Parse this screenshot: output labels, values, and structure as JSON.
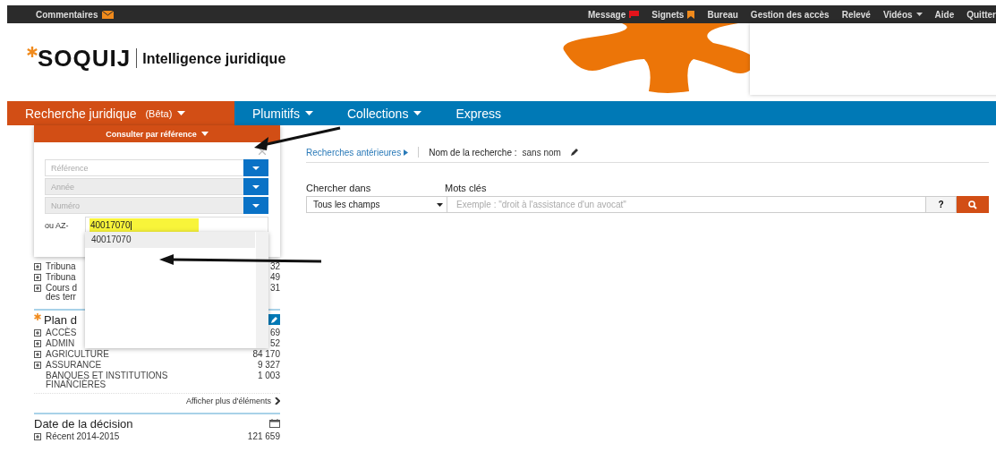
{
  "top_bar": {
    "feedback": "Commentaires",
    "links": [
      {
        "label": "Message",
        "kind": "flag"
      },
      {
        "label": "Signets",
        "kind": "bookmark"
      },
      {
        "label": "Bureau",
        "kind": "plain"
      },
      {
        "label": "Gestion des accès",
        "kind": "plain"
      },
      {
        "label": "Relevé",
        "kind": "plain"
      },
      {
        "label": "Vidéos",
        "kind": "dropdown"
      },
      {
        "label": "Aide",
        "kind": "plain"
      },
      {
        "label": "Quitter",
        "kind": "plain"
      }
    ]
  },
  "header": {
    "brand": "SOQUIJ",
    "tagline": "Intelligence juridique"
  },
  "nav": [
    {
      "label": "Recherche juridique",
      "badge": "(Bêta)",
      "selected": true,
      "dropdown": true
    },
    {
      "label": "Plumitifs",
      "selected": false,
      "dropdown": true
    },
    {
      "label": "Collections",
      "selected": false,
      "dropdown": true
    },
    {
      "label": "Express",
      "selected": false,
      "dropdown": false
    }
  ],
  "sidebar": {
    "courts": [
      {
        "lines": [
          "Tribuna"
        ],
        "count": "32"
      },
      {
        "lines": [
          "Tribuna"
        ],
        "count": "49"
      },
      {
        "lines": [
          "Cours d",
          "des terr"
        ],
        "count": "31"
      }
    ],
    "plan": {
      "title": "Plan d",
      "items": [
        {
          "lines": [
            "ACCÈS"
          ],
          "count": "69",
          "expandable": true
        },
        {
          "lines": [
            "ADMIN"
          ],
          "count": "52",
          "expandable": true
        },
        {
          "lines": [
            "AGRICULTURE"
          ],
          "count": "84 170",
          "expandable": true
        },
        {
          "lines": [
            "ASSURANCE"
          ],
          "count": "9 327",
          "expandable": true
        },
        {
          "lines": [
            "BANQUES ET INSTITUTIONS",
            "FINANCIÈRES"
          ],
          "count": "1 003",
          "expandable": false
        }
      ],
      "more": "Afficher plus d'éléments"
    },
    "date": {
      "title": "Date de la décision",
      "items": [
        {
          "lines": [
            "Récent 2014-2015"
          ],
          "count": "121 659"
        }
      ]
    }
  },
  "popup": {
    "title": "Consulter par référence",
    "fields": [
      {
        "placeholder": "Référence",
        "disabled": false
      },
      {
        "placeholder": "Année",
        "disabled": true
      },
      {
        "placeholder": "Numéro",
        "disabled": true
      }
    ],
    "az_label": "ou AZ-",
    "az_value": "40017070",
    "suggestions": [
      {
        "label": "40017070",
        "selected": true
      }
    ]
  },
  "search": {
    "history_link": "Recherches antérieures",
    "name_label": "Nom de la recherche :",
    "name_value": "sans nom",
    "scope_label": "Chercher dans",
    "scope_value": "Tous les champs",
    "keywords_label": "Mots clés",
    "keywords_placeholder": "Exemple : \"droit à l'assistance d'un avocat\"",
    "help": "?"
  }
}
